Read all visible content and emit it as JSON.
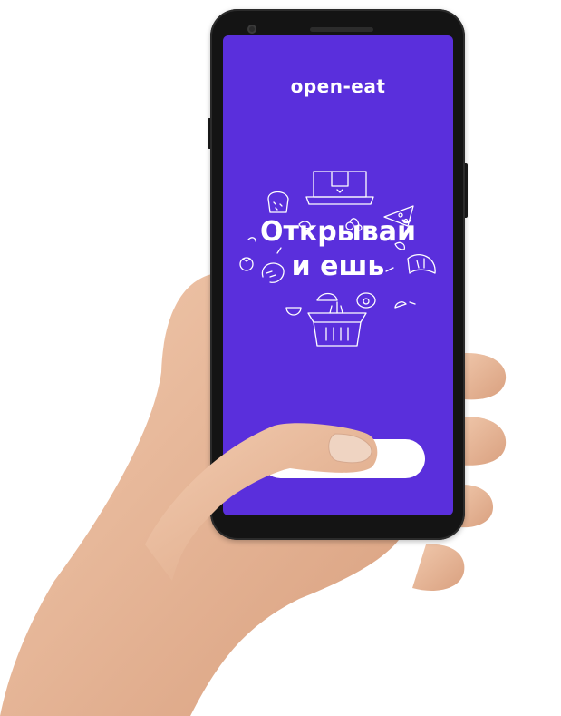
{
  "app": {
    "logo_text": "open-eat",
    "headline_line1": "Открывай",
    "headline_line2": "и ешь",
    "cta_label": ""
  },
  "colors": {
    "screen_background": "#5a2fdc",
    "accent_white": "#ffffff",
    "phone_body": "#141414",
    "skin": "#e8b797"
  },
  "icons": {
    "illustration": [
      "box-icon",
      "bread-icon",
      "cheese-icon",
      "cherry-icon",
      "citrus-icon",
      "shrimp-icon",
      "croissant-icon",
      "egg-icon",
      "avocado-icon",
      "leaf-icon",
      "basket-icon",
      "tomato-icon"
    ]
  }
}
